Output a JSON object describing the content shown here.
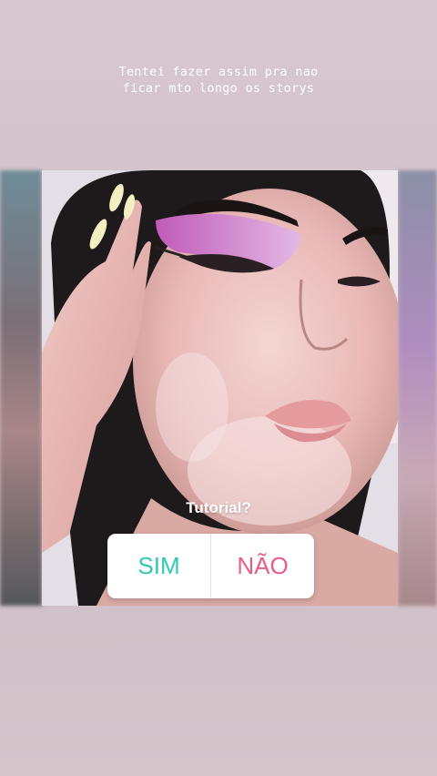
{
  "story": {
    "caption_lines": [
      "Tentei fazer assim pra nao",
      "ficar mto longo os storys"
    ]
  },
  "poll": {
    "question": "Tutorial?",
    "options": [
      {
        "label": "SIM",
        "color": "#2fc8b7"
      },
      {
        "label": "NÃO",
        "color": "#e85d87"
      }
    ]
  },
  "colors": {
    "background": "#d6c6cd",
    "eyeshadow": "#b56bb8",
    "lips": "#e59a9e"
  }
}
